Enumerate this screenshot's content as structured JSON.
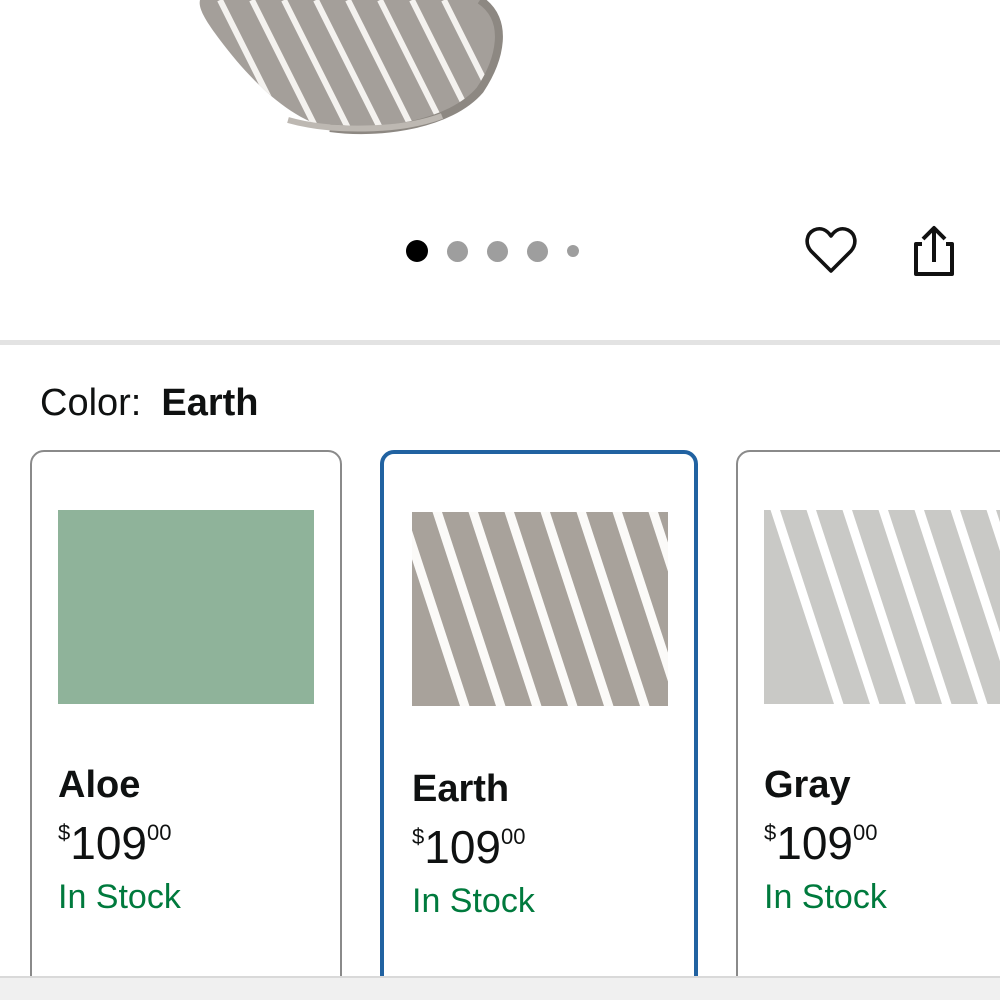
{
  "carousel": {
    "dot_count": 5,
    "active_index": 0
  },
  "actions": {
    "favorite_icon": "heart-icon",
    "share_icon": "share-icon"
  },
  "color_selector": {
    "label": "Color:",
    "selected_value": "Earth",
    "accent_color": "#2162a1",
    "options": [
      {
        "name": "Aloe",
        "price_symbol": "$",
        "price_whole": "109",
        "price_fraction": "00",
        "availability": "In Stock",
        "swatch_color": "#8fb39a"
      },
      {
        "name": "Earth",
        "price_symbol": "$",
        "price_whole": "109",
        "price_fraction": "00",
        "availability": "In Stock",
        "swatch_color": "#a8a29b"
      },
      {
        "name": "Gray",
        "price_symbol": "$",
        "price_whole": "109",
        "price_fraction": "00",
        "availability": "In Stock",
        "swatch_color": "#c9c9c6"
      }
    ]
  },
  "availability_color": "#007a3d"
}
